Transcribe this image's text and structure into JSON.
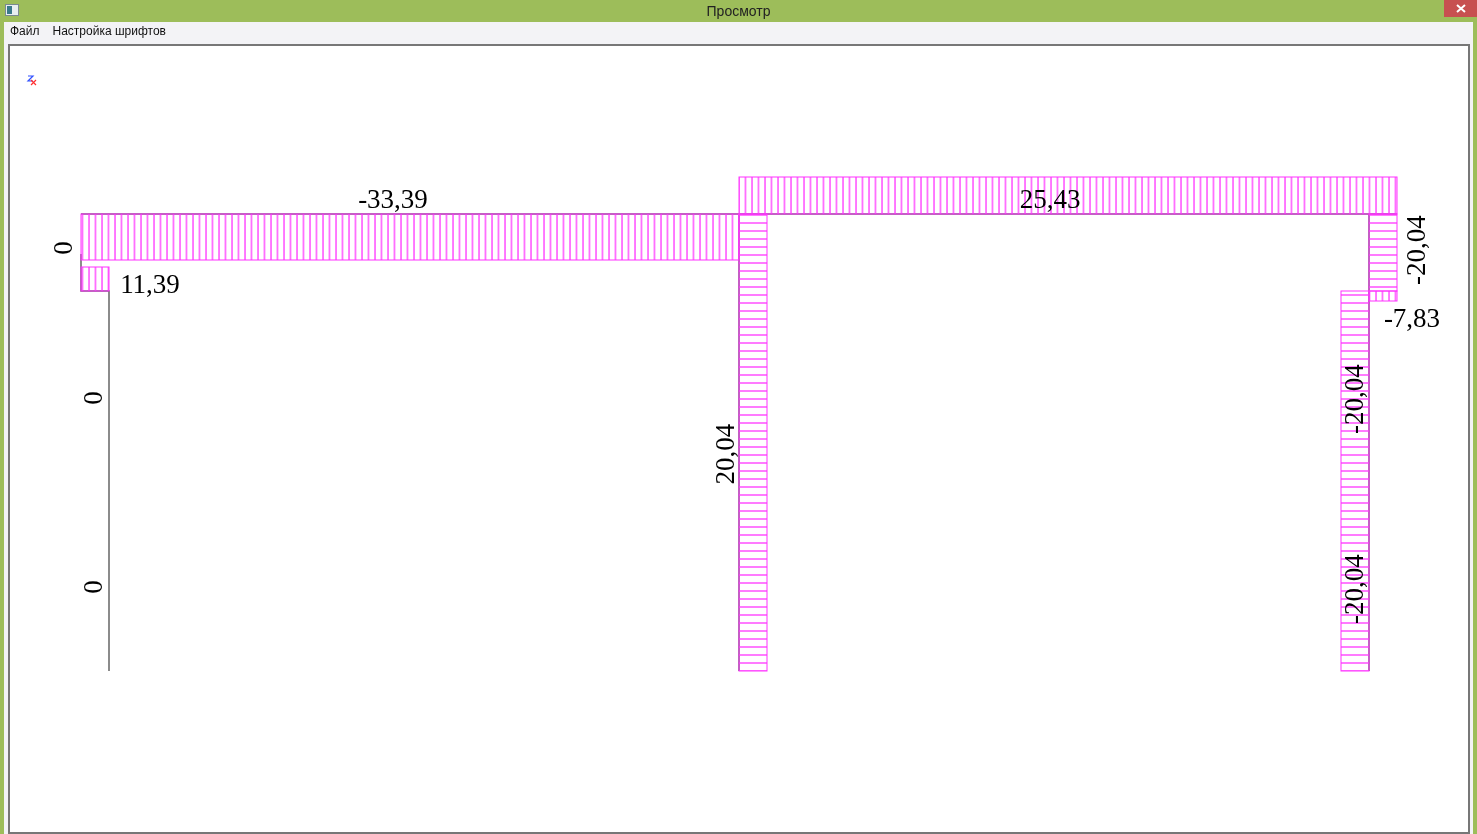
{
  "window": {
    "title": "Просмотр"
  },
  "menu": [
    "Файл",
    "Настройка шрифтов"
  ],
  "diagram": {
    "segments": [
      {
        "label": "-33,39",
        "kind": "vertical"
      },
      {
        "label": "11,39",
        "kind": "vertical"
      },
      {
        "label": "25,43",
        "kind": "vertical"
      },
      {
        "label": "20,04",
        "kind": "horizontal"
      },
      {
        "label": "-20,04",
        "kind": "horizontal"
      },
      {
        "label": "-7,83",
        "kind": "vertical"
      },
      {
        "label": "-20,04",
        "kind": "horizontal"
      }
    ],
    "extra_labels": [
      "-20,04",
      "0",
      "0",
      "0"
    ]
  }
}
